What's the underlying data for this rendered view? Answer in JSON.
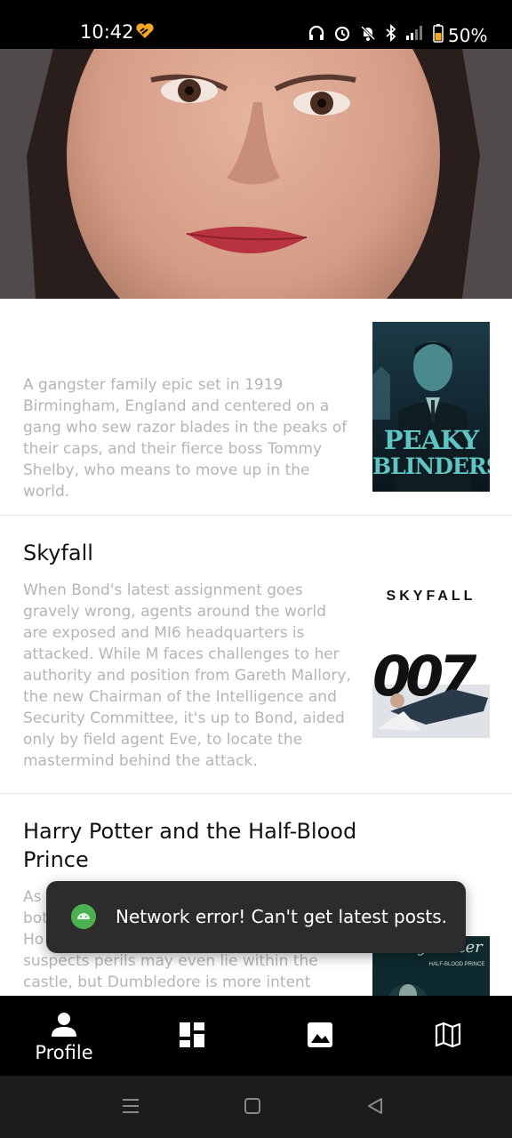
{
  "status_bar": {
    "time": "10:42",
    "battery": "50%",
    "icons": [
      "heart-badge-icon",
      "headphones-icon",
      "alarm-icon",
      "bell-off-icon",
      "bluetooth-icon",
      "signal-icon",
      "battery-icon"
    ]
  },
  "posts": [
    {
      "title": "",
      "description": "A gangster family epic set in 1919 Birmingham, England and centered on a gang who sew razor blades in the peaks of their caps, and their fierce boss Tommy Shelby, who means to move up in the world.",
      "poster_text": [
        "PEAKY",
        "BLINDERS"
      ]
    },
    {
      "title": "Skyfall",
      "description": "When Bond's latest assignment goes gravely wrong, agents around the world are exposed and MI6 headquarters is attacked. While M faces challenges to her authority and position from Gareth Mallory, the new Chairman of the Intelligence and Security Committee, it's up to Bond, aided only by field agent Eve, to locate the mastermind behind the attack.",
      "poster_text": [
        "SKYFALL",
        "007"
      ]
    },
    {
      "title": "Harry Potter and the Half-Blood Prince",
      "description": "As ... both ... Ho... suspects perils may even lie within the castle, but Dumbledore is more intent",
      "desc_lines": [
        "As",
        "bot",
        "Ho",
        "suspects perils may even lie within the",
        "castle, but Dumbledore is more intent"
      ],
      "poster_text": [
        "Harry Potter",
        "HALF-BLOOD PRINCE"
      ]
    }
  ],
  "toast": {
    "message": "Network error! Can't get latest posts."
  },
  "bottom_nav": {
    "items": [
      {
        "label": "Profile",
        "icon": "person-icon",
        "active": true
      },
      {
        "label": "",
        "icon": "dashboard-icon"
      },
      {
        "label": "",
        "icon": "image-icon"
      },
      {
        "label": "",
        "icon": "map-icon"
      }
    ]
  },
  "colors": {
    "nav_bg": "#000000",
    "toast_bg": "#2c2c2c",
    "desc_text": "#b5b5b5",
    "android_green": "#4caf50"
  }
}
